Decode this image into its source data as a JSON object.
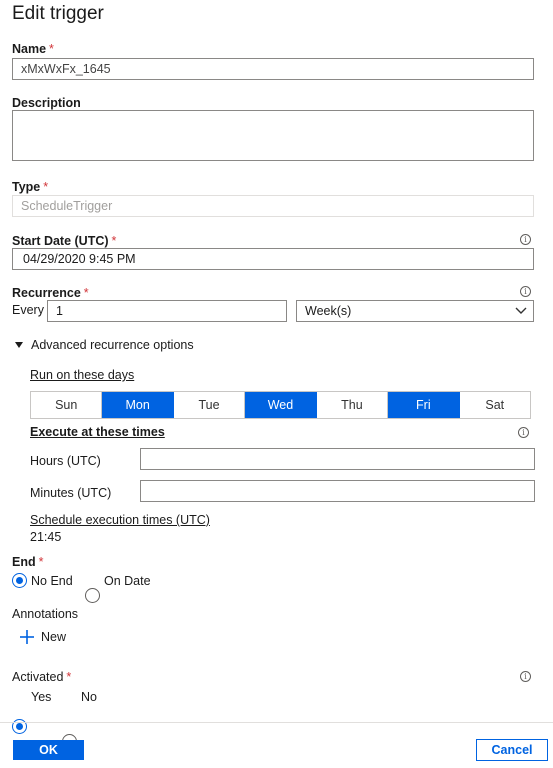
{
  "dialog": {
    "title": "Edit trigger"
  },
  "name": {
    "label": "Name",
    "required": "*",
    "value": "xMxWxFx_1645"
  },
  "description": {
    "label": "Description",
    "value": ""
  },
  "type": {
    "label": "Type",
    "required": "*",
    "value": "ScheduleTrigger"
  },
  "start_date": {
    "label": "Start Date (UTC)",
    "required": "*",
    "value": "04/29/2020 9:45 PM",
    "info_icon": "info-icon"
  },
  "recurrence": {
    "label": "Recurrence",
    "required": "*",
    "every_label": "Every",
    "interval": "1",
    "unit": "Week(s)",
    "info_icon": "info-icon"
  },
  "advanced": {
    "toggle_label": "Advanced recurrence options",
    "days_label": "Run on these days",
    "days": [
      {
        "label": "Sun",
        "selected": false
      },
      {
        "label": "Mon",
        "selected": true
      },
      {
        "label": "Tue",
        "selected": false
      },
      {
        "label": "Wed",
        "selected": true
      },
      {
        "label": "Thu",
        "selected": false
      },
      {
        "label": "Fri",
        "selected": true
      },
      {
        "label": "Sat",
        "selected": false
      }
    ],
    "times_label": "Execute at these times",
    "hours_label": "Hours (UTC)",
    "hours_value": "",
    "minutes_label": "Minutes (UTC)",
    "minutes_value": "",
    "schedule_label": "Schedule execution times (UTC)",
    "schedule_value": "21:45"
  },
  "end": {
    "label": "End",
    "required": "*",
    "options": [
      "No End",
      "On Date"
    ],
    "selected": "No End"
  },
  "annotations": {
    "label": "Annotations",
    "new_label": "New"
  },
  "activated": {
    "label": "Activated",
    "required": "*",
    "options": [
      "Yes",
      "No"
    ],
    "selected": "Yes"
  },
  "footer": {
    "ok_label": "OK",
    "cancel_label": "Cancel"
  },
  "colors": {
    "accent": "#0063e1",
    "required": "#d13438"
  }
}
